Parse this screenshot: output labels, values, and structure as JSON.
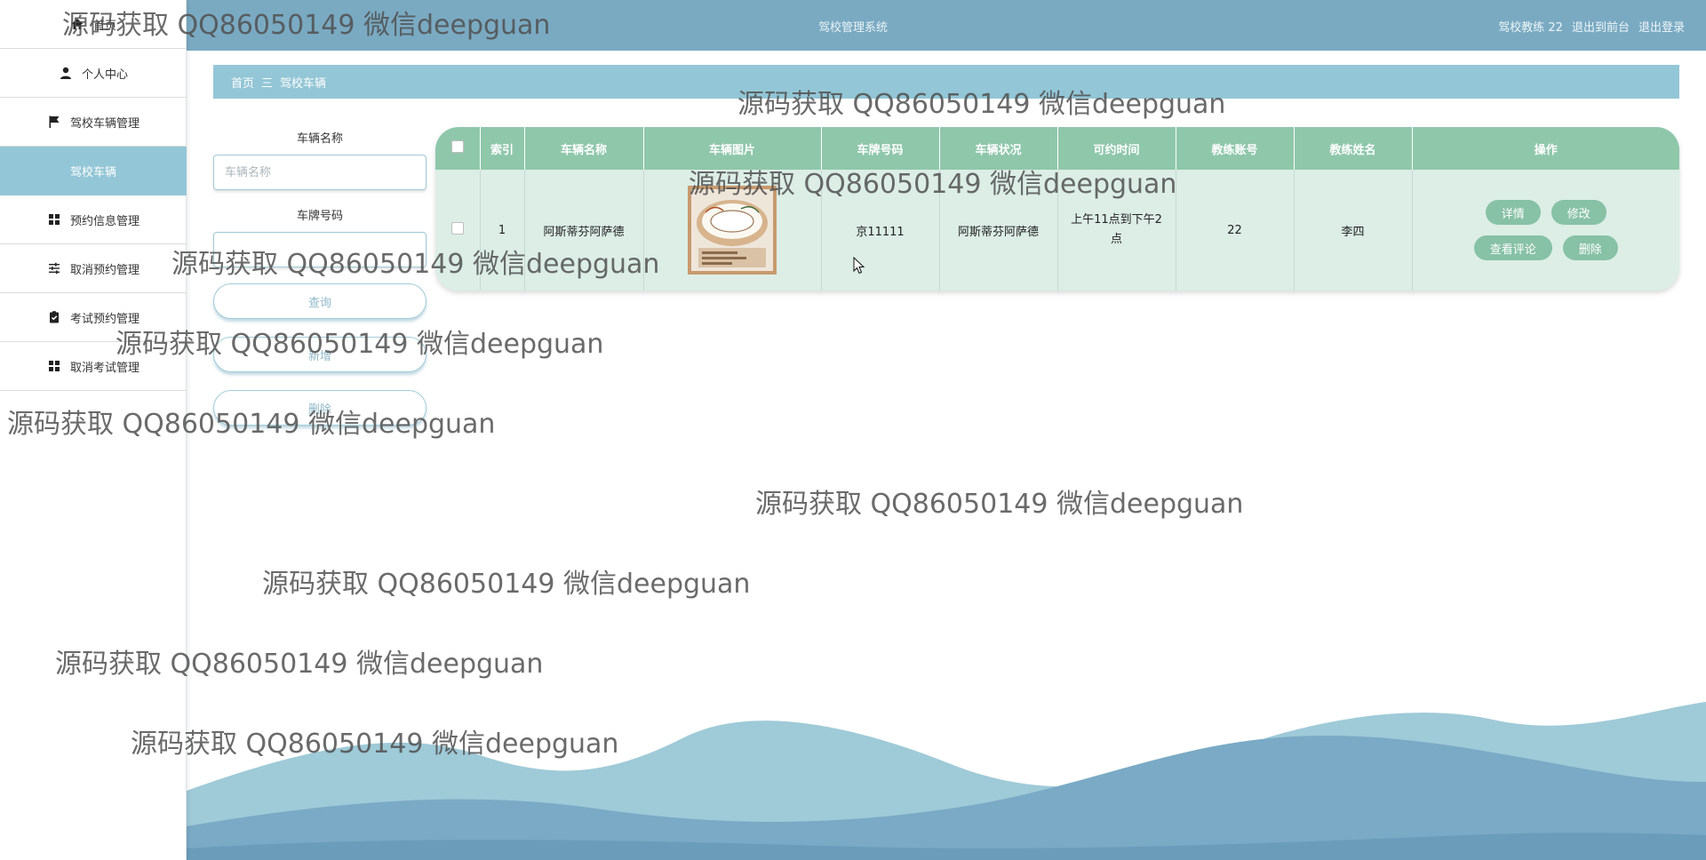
{
  "header": {
    "system_title": "驾校管理系统",
    "user": "驾校教练 22",
    "to_front": "退出到前台",
    "logout": "退出登录"
  },
  "sidebar": {
    "items": [
      {
        "label": "首页",
        "icon": "home-icon"
      },
      {
        "label": "个人中心",
        "icon": "user-icon"
      },
      {
        "label": "驾校车辆管理",
        "icon": "flag-icon"
      },
      {
        "label": "驾校车辆",
        "icon": "",
        "active": true
      },
      {
        "label": "预约信息管理",
        "icon": "grid-icon"
      },
      {
        "label": "取消预约管理",
        "icon": "sliders-icon"
      },
      {
        "label": "考试预约管理",
        "icon": "clipboard-check-icon"
      },
      {
        "label": "取消考试管理",
        "icon": "grid-icon"
      }
    ]
  },
  "breadcrumb": {
    "home": "首页",
    "separator": "三",
    "current": "驾校车辆"
  },
  "search": {
    "vehicle_name_label": "车辆名称",
    "vehicle_name_placeholder": "车辆名称",
    "plate_label": "车牌号码",
    "query_button": "查询",
    "add_button": "新增",
    "delete_button": "删除"
  },
  "table": {
    "columns": [
      "索引",
      "车辆名称",
      "车辆图片",
      "车牌号码",
      "车辆状况",
      "可约时间",
      "教练账号",
      "教练姓名",
      "操作"
    ],
    "rows": [
      {
        "index": "1",
        "vehicle_name": "阿斯蒂芬阿萨德",
        "plate": "京11111",
        "condition": "阿斯蒂芬阿萨德",
        "available_time": "上午11点到下午2点",
        "coach_account": "22",
        "coach_name": "李四"
      }
    ],
    "actions": {
      "detail": "详情",
      "edit": "修改",
      "view_comments": "查看评论",
      "delete": "删除"
    }
  },
  "watermark": "源码获取 QQ86050149 微信deepguan",
  "colors": {
    "topbar": "#7aaac2",
    "accent": "#93c6d6",
    "table_header": "#8fc7ab",
    "table_row": "#dceee6",
    "action_button": "#87c1a6"
  }
}
